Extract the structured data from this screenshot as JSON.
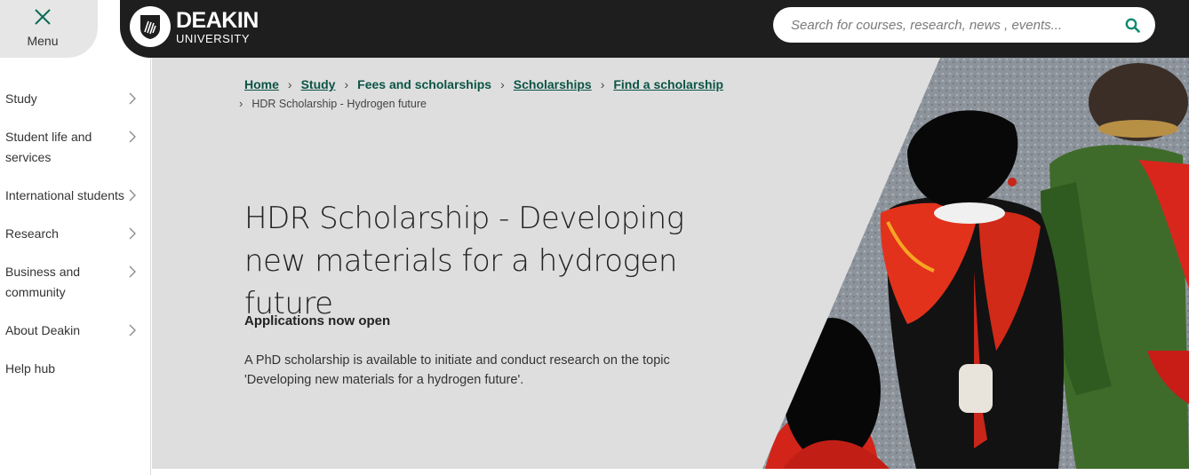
{
  "header": {
    "menu_label": "Menu",
    "logo_main": "DEAKIN",
    "logo_sub": "UNIVERSITY",
    "search_placeholder": "Search for courses, research, news , events..."
  },
  "sidebar": {
    "items": [
      {
        "label": "Study"
      },
      {
        "label": "Student life and services"
      },
      {
        "label": "International students"
      },
      {
        "label": "Research"
      },
      {
        "label": "Business and community"
      },
      {
        "label": "About Deakin"
      },
      {
        "label": "Help hub"
      }
    ]
  },
  "breadcrumb": {
    "home": "Home",
    "study": "Study",
    "fees": "Fees and scholarships",
    "scholarships": "Scholarships",
    "find": "Find a scholarship",
    "current": "HDR Scholarship - Hydrogen future"
  },
  "hero": {
    "title": "HDR Scholarship - Developing new materials for a hydrogen future",
    "status": "Applications now open",
    "description": "A PhD scholarship is available to initiate and conduct research on the topic 'Developing new materials for a hydrogen future'."
  },
  "colors": {
    "topbar": "#1e1e1e",
    "link": "#0b5445",
    "hero_bg": "#dedede",
    "search_icon": "#0b8a6e"
  }
}
